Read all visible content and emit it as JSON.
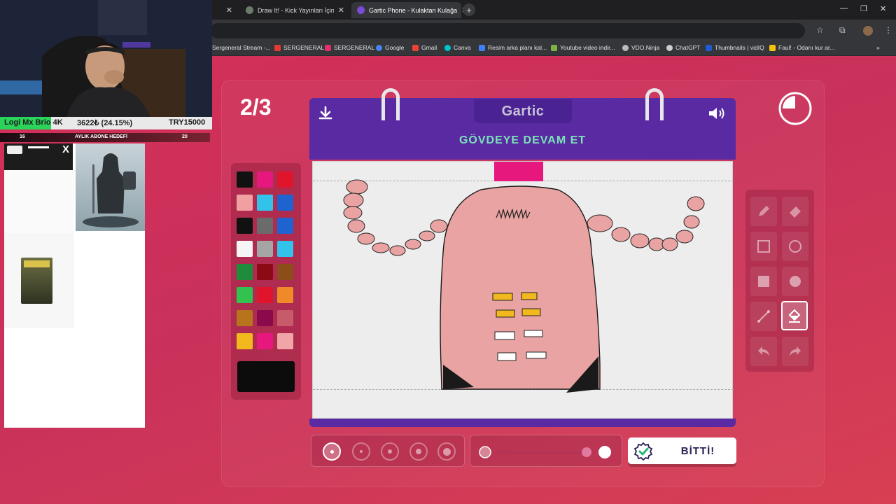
{
  "browser": {
    "tabs": [
      {
        "label": "",
        "active": false
      },
      {
        "label": "Draw It! - Kick Yayınları İçin Çiz",
        "active": false
      },
      {
        "label": "Gartic Phone - Kulaktan Kulağa",
        "active": true
      }
    ],
    "new_tab": "+",
    "bookmarks": [
      {
        "label": "Sergeneral Stream -...",
        "color": "#9b59b6"
      },
      {
        "label": "SERGENERAL",
        "color": "#e53935"
      },
      {
        "label": "SERGENERAL",
        "color": "#e1306c"
      },
      {
        "label": "Google",
        "color": "#4285f4"
      },
      {
        "label": "Gmail",
        "color": "#ea4335"
      },
      {
        "label": "Canva",
        "color": "#00c4cc"
      },
      {
        "label": "Resim arka planı kal...",
        "color": "#3b82f6"
      },
      {
        "label": "Youtube video indir...",
        "color": "#7cb342"
      },
      {
        "label": "VDO.Ninja",
        "color": "#bbbbbb"
      },
      {
        "label": "ChatGPT",
        "color": "#cccccc"
      },
      {
        "label": "Thumbnails | vidIQ",
        "color": "#1e5bd6"
      },
      {
        "label": "Faul! - Odanı kur ar...",
        "color": "#f4c20d"
      }
    ]
  },
  "game": {
    "round": "2/3",
    "logo": "Gartic",
    "instruction": "GÖVDEYE DEVAM ET",
    "done_label": "BİTTİ!",
    "timer_fraction_remaining": 0.75,
    "selected_tool": "fill",
    "selected_color": "#0c0c0c",
    "selected_brush_size": 1,
    "opacity_level": 1.0,
    "palette": [
      [
        "#111111",
        "#e6187e",
        "#e0142b"
      ],
      [
        "#f0a0a0",
        "#33c3ea",
        "#1f63d1"
      ],
      [
        "#111111",
        "#6b6b6b",
        "#1f63d1"
      ],
      [
        "#f5f5f5",
        "#a5a5a5",
        "#33c3ea"
      ],
      [
        "#1e8c3a",
        "#8b0a14",
        "#8b4e1a"
      ],
      [
        "#33c24f",
        "#e0142b",
        "#f08a28"
      ],
      [
        "#b8731d",
        "#8b0a4c",
        "#c85b6a"
      ],
      [
        "#f2b81e",
        "#e6187e",
        "#f0a6a6"
      ]
    ],
    "tools": [
      "pencil",
      "eraser",
      "rectangle-outline",
      "circle-outline",
      "rectangle-filled",
      "circle-filled",
      "line",
      "fill",
      "undo",
      "redo"
    ]
  },
  "stream": {
    "donation_label": "Logi Mx Brio 4K",
    "donation_progress": "3622₺ (24.15%)",
    "donation_goal": "TRY15000",
    "donation_fraction": 0.2415,
    "sub_goal_current": "16",
    "sub_goal_label": "AYLIK ABONE HEDEFİ",
    "sub_goal_target": "20",
    "close_mark": "X"
  }
}
